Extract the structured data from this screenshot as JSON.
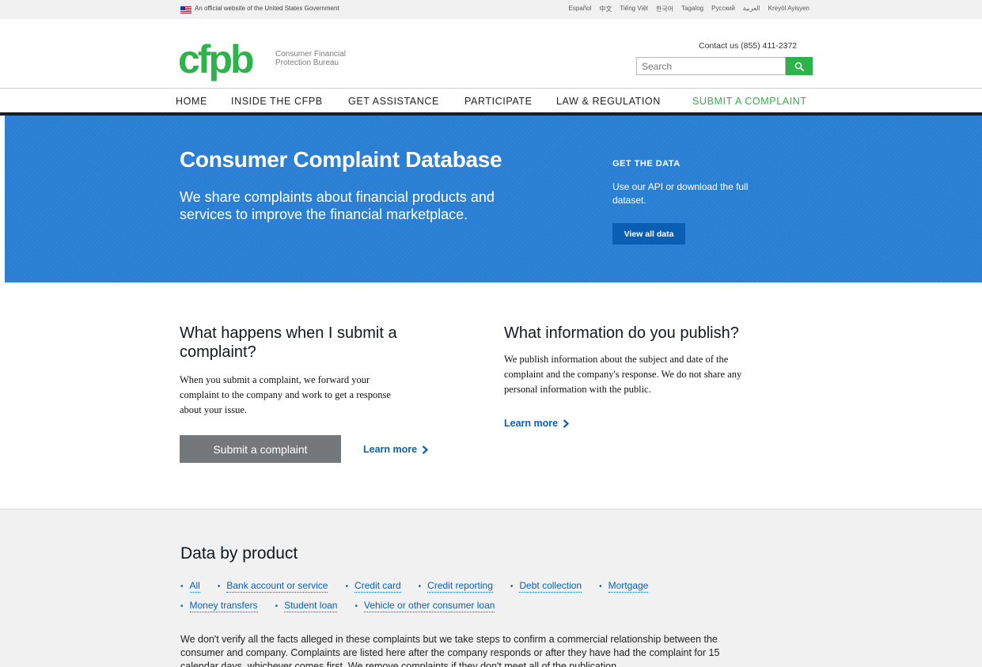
{
  "gov_banner": {
    "text": "An official website of the United States Government",
    "languages": [
      "Español",
      "中文",
      "Tiếng Việt",
      "한국어",
      "Tagalog",
      "Русский",
      "العربية",
      "Kreyòl Ayisyen"
    ]
  },
  "header": {
    "logo_mark": "cfpb",
    "logo_line1": "Consumer Financial",
    "logo_line2": "Protection Bureau",
    "contact": "Contact us (855) 411-2372",
    "search_placeholder": "Search"
  },
  "nav": {
    "items": [
      "HOME",
      "INSIDE THE CFPB",
      "GET ASSISTANCE",
      "PARTICIPATE",
      "LAW & REGULATION",
      "SUBMIT A COMPLAINT"
    ]
  },
  "hero": {
    "title": "Consumer Complaint Database",
    "subtitle": "We share complaints about financial products and services to improve the financial marketplace.",
    "data_heading": "GET THE DATA",
    "data_text": "Use our API or download the full dataset.",
    "data_button": "View all data"
  },
  "col_left": {
    "heading": "What happens when I submit a complaint?",
    "text": "When you submit a complaint, we forward your complaint to the company and work to get a response about your issue.",
    "button": "Submit a complaint",
    "link": "Learn more"
  },
  "col_right": {
    "heading": "What information do you publish?",
    "text": "We publish information about the subject and date of the complaint and the company's response. We do not share any personal information with the public.",
    "link": "Learn more"
  },
  "products": {
    "heading": "Data by product",
    "row1": [
      "All",
      "Bank account or service",
      "Credit card",
      "Credit reporting",
      "Debt collection",
      "Mortgage"
    ],
    "row2": [
      "Money transfers",
      "Student loan",
      "Vehicle or other consumer loan"
    ],
    "disclaimer": "We don't verify all the facts alleged in these complaints but we take steps to confirm a commercial relationship between the consumer and company. Complaints are listed here after the company responds or after they have had the complaint for 15 calendar days, whichever comes first. We remove complaints if they don't meet all of the publication"
  },
  "colors": {
    "brand_green": "#2cb34a",
    "hero_blue": "#2a7fd4",
    "link_blue": "#0a5fb4"
  }
}
